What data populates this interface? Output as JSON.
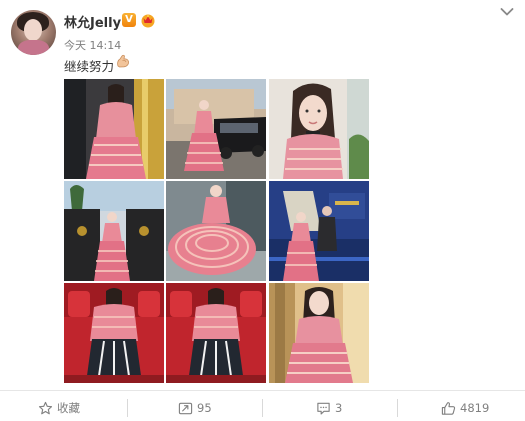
{
  "post": {
    "author": "林允Jelly",
    "verified_badge": "V",
    "timestamp": "今天 14:14",
    "text": "继续努力",
    "emoji": "flexed-biceps"
  },
  "photos": [
    "pink-dress-backstage",
    "pink-dress-by-car",
    "pink-dress-portrait",
    "pink-dress-red-carpet",
    "pink-dress-twirl",
    "pink-dress-on-stage",
    "pink-dress-theater-seat",
    "pink-dress-theater-seat-2",
    "pink-dress-golden-light"
  ],
  "actions": {
    "favorite_label": "收藏",
    "repost_count": "95",
    "comment_count": "3",
    "like_count": "4819"
  },
  "colors": {
    "accent_orange": "#f39c12",
    "text_gray": "#808080",
    "divider": "#e6e6e6",
    "dress_pink": "#e8889a"
  }
}
